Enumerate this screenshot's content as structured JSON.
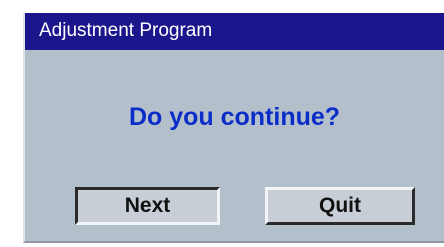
{
  "window": {
    "title": "Adjustment Program"
  },
  "dialog": {
    "question": "Do you continue?"
  },
  "buttons": {
    "next_label": "Next",
    "quit_label": "Quit"
  },
  "colors": {
    "titlebar": "#1c168d",
    "dialog_background": "#b4bfcc",
    "question_text": "#0a2dc8",
    "button_face": "#c8ced6"
  }
}
